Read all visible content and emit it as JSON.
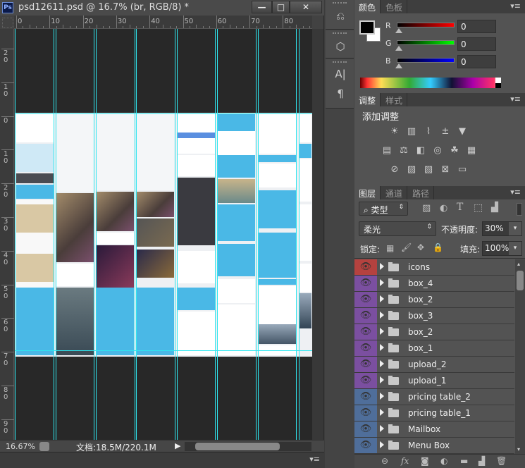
{
  "document": {
    "title": "psd12611.psd @ 16.7% (br, RGB/8) *",
    "app_icon": "Ps",
    "window_buttons": {
      "minimize": "—",
      "maximize": "□",
      "close": "✕"
    },
    "h_ruler_labels": [
      "0",
      "10",
      "20",
      "30",
      "40",
      "50",
      "60",
      "70",
      "80"
    ],
    "v_ruler_labels": [
      "20",
      "10",
      "0",
      "10",
      "20",
      "30",
      "40",
      "50",
      "60",
      "70",
      "80",
      "90"
    ],
    "guide_color": "#2ee6ef",
    "status": {
      "zoom": "16.67%",
      "doc_info": "文档:18.5M/220.1M",
      "arrow": "▶"
    }
  },
  "tool_column": {
    "icons": [
      "history-icon",
      "3d-icon",
      "character-icon",
      "paragraph-icon"
    ]
  },
  "color_panel": {
    "tabs": [
      "颜色",
      "色板"
    ],
    "foreground": "#000000",
    "background": "#ffffff",
    "channels": [
      {
        "label": "R",
        "value": "0",
        "color": "#ff0000"
      },
      {
        "label": "G",
        "value": "0",
        "color": "#00ff00"
      },
      {
        "label": "B",
        "value": "0",
        "color": "#0000ff"
      }
    ]
  },
  "adjust_panel": {
    "tabs": [
      "调整",
      "样式"
    ],
    "heading": "添加调整",
    "icons": [
      [
        "brightness-icon",
        "levels-icon",
        "curves-icon",
        "exposure-icon",
        "vibrance-icon"
      ],
      [
        "hue-saturation-icon",
        "color-balance-icon",
        "black-white-icon",
        "photo-filter-icon",
        "channel-mixer-icon",
        "color-lookup-icon"
      ],
      [
        "invert-icon",
        "posterize-icon",
        "threshold-icon",
        "selective-color-icon",
        "gradient-map-icon"
      ]
    ]
  },
  "layers_panel": {
    "tabs": [
      "图层",
      "通道",
      "路径"
    ],
    "filter": "类型",
    "blend_mode": "柔光",
    "opacity_label": "不透明度:",
    "opacity": "30%",
    "lock_label": "锁定:",
    "fill_label": "填充:",
    "fill": "100%",
    "layers": [
      {
        "name": "icons",
        "color": "#b5423f"
      },
      {
        "name": "box_4",
        "color": "#7b4fa0"
      },
      {
        "name": "box_2",
        "color": "#7b4fa0"
      },
      {
        "name": "box_3",
        "color": "#7b4fa0"
      },
      {
        "name": "box_2",
        "color": "#7b4fa0"
      },
      {
        "name": "box_1",
        "color": "#7b4fa0"
      },
      {
        "name": "upload_2",
        "color": "#7b4fa0"
      },
      {
        "name": "upload_1",
        "color": "#7b4fa0"
      },
      {
        "name": "pricing table_2",
        "color": "#4f6e9a"
      },
      {
        "name": "pricing table_1",
        "color": "#4f6e9a"
      },
      {
        "name": "Mailbox",
        "color": "#4f6e9a"
      },
      {
        "name": "Menu Box",
        "color": "#4f6e9a"
      }
    ],
    "footer_icons": [
      "link-icon",
      "fx-icon",
      "mask-icon",
      "adjustment-icon",
      "group-icon",
      "new-layer-icon",
      "trash-icon"
    ]
  }
}
